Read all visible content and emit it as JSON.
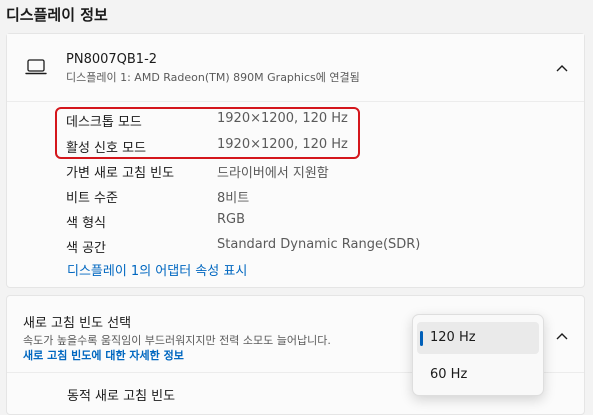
{
  "section_title": "디스플레이 정보",
  "device": {
    "name": "PN8007QB1-2",
    "subtitle": "디스플레이 1: AMD Radeon(TM) 890M Graphics에 연결됨"
  },
  "info_rows": [
    {
      "label": "데스크톱 모드",
      "value": "1920×1200, 120 Hz"
    },
    {
      "label": "활성 신호 모드",
      "value": "1920×1200, 120 Hz"
    },
    {
      "label": "가변 새로 고침 빈도",
      "value": "드라이버에서 지원함"
    },
    {
      "label": "비트 수준",
      "value": "8비트"
    },
    {
      "label": "색 형식",
      "value": "RGB"
    },
    {
      "label": "색 공간",
      "value": "Standard Dynamic Range(SDR)"
    }
  ],
  "adapter_link": "디스플레이 1의 어댑터 속성 표시",
  "refresh": {
    "title": "새로 고침 빈도 선택",
    "description": "속도가 높을수록 움직임이 부드러워지지만 전력 소모도 늘어납니다.",
    "link": "새로 고침 빈도에 대한 자세한 정보",
    "sub_item": "동적 새로 고침 빈도",
    "options": [
      "120 Hz",
      "60 Hz"
    ],
    "selected": "120 Hz"
  },
  "colors": {
    "accent": "#005fb8",
    "link": "#0067c0",
    "highlight": "#d4161c"
  }
}
